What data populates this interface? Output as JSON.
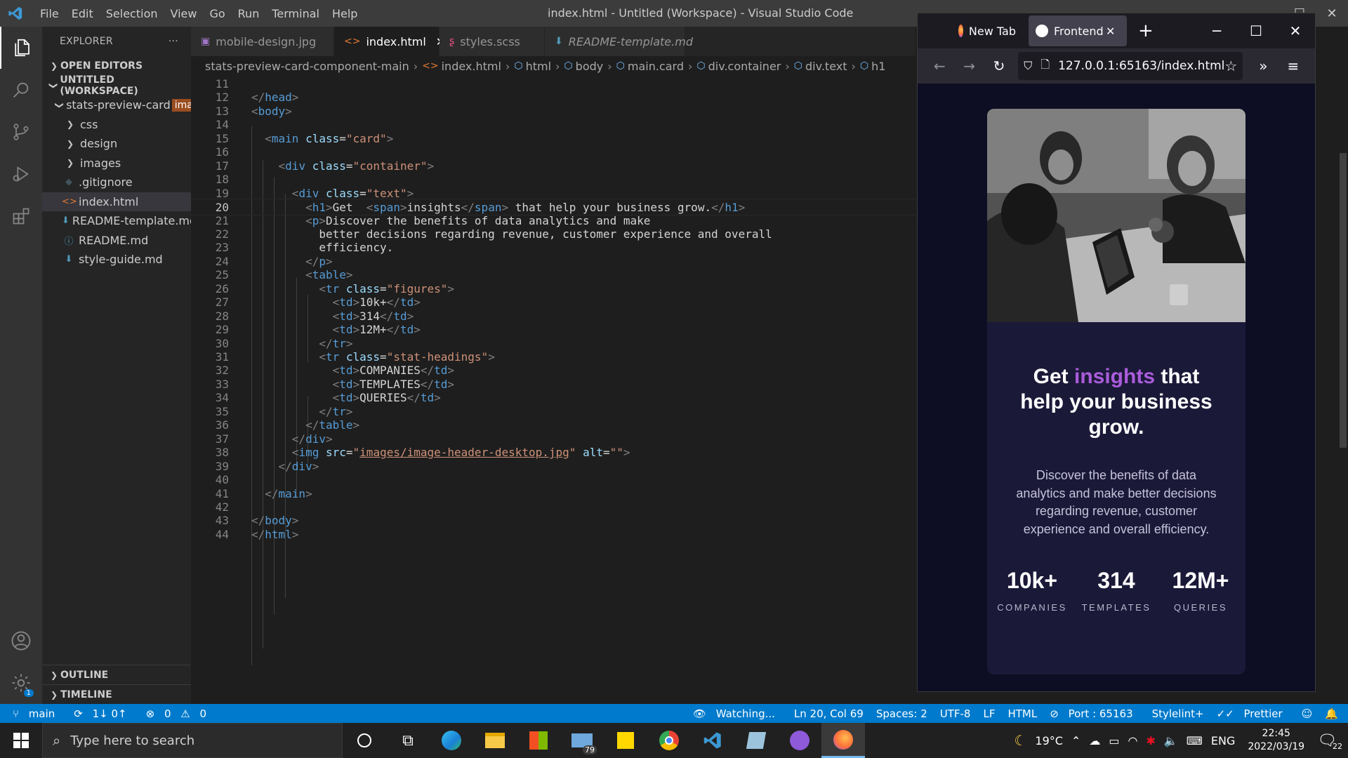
{
  "titlebar": {
    "menu": [
      "File",
      "Edit",
      "Selection",
      "View",
      "Go",
      "Run",
      "Terminal",
      "Help"
    ],
    "title": "index.html - Untitled (Workspace) - Visual Studio Code"
  },
  "activitybar": {
    "icons": [
      "explorer-icon",
      "search-icon",
      "source-control-icon",
      "run-debug-icon",
      "extensions-icon"
    ],
    "bottom_icons": [
      "accounts-icon",
      "settings-gear-icon"
    ],
    "settings_badge": "1"
  },
  "sidebar": {
    "header": "EXPLORER",
    "more": "···",
    "open_editors": "OPEN EDITORS",
    "workspace": "UNTITLED (WORKSPACE)",
    "root_folder": "stats-preview-card",
    "hover_tooltip": "ima",
    "items": [
      {
        "label": "css",
        "type": "folder"
      },
      {
        "label": "design",
        "type": "folder"
      },
      {
        "label": "images",
        "type": "folder"
      },
      {
        "label": ".gitignore",
        "type": "file"
      },
      {
        "label": "index.html",
        "type": "file"
      },
      {
        "label": "README-template.md",
        "type": "file"
      },
      {
        "label": "README.md",
        "type": "file"
      },
      {
        "label": "style-guide.md",
        "type": "file"
      }
    ],
    "outline": "OUTLINE",
    "timeline": "TIMELINE"
  },
  "tabs": [
    {
      "label": "mobile-design.jpg",
      "active": false
    },
    {
      "label": "index.html",
      "active": true
    },
    {
      "label": "styles.scss",
      "active": false
    },
    {
      "label": "README-template.md",
      "active": false
    }
  ],
  "breadcrumb": [
    "stats-preview-card-component-main",
    "index.html",
    "html",
    "body",
    "main.card",
    "div.container",
    "div.text",
    "h1"
  ],
  "editor": {
    "current_line": 20,
    "lines": [
      {
        "n": "11",
        "code": ""
      },
      {
        "n": "12",
        "code": "</head>"
      },
      {
        "n": "13",
        "code": "<body>"
      },
      {
        "n": "14",
        "code": ""
      },
      {
        "n": "15",
        "code": "  <main class=\"card\">"
      },
      {
        "n": "16",
        "code": ""
      },
      {
        "n": "17",
        "code": "    <div class=\"container\">"
      },
      {
        "n": "18",
        "code": ""
      },
      {
        "n": "19",
        "code": "      <div class=\"text\">"
      },
      {
        "n": "20",
        "code": "        <h1>Get  <span>insights</span> that help your business grow.</h1>"
      },
      {
        "n": "21",
        "code": "        <p>Discover the benefits of data analytics and make"
      },
      {
        "n": "22",
        "code": "          better decisions regarding revenue, customer experience and overall"
      },
      {
        "n": "23",
        "code": "          efficiency."
      },
      {
        "n": "24",
        "code": "        </p>"
      },
      {
        "n": "25",
        "code": "        <table>"
      },
      {
        "n": "26",
        "code": "          <tr class=\"figures\">"
      },
      {
        "n": "27",
        "code": "            <td>10k+</td>"
      },
      {
        "n": "28",
        "code": "            <td>314</td>"
      },
      {
        "n": "29",
        "code": "            <td>12M+</td>"
      },
      {
        "n": "30",
        "code": "          </tr>"
      },
      {
        "n": "31",
        "code": "          <tr class=\"stat-headings\">"
      },
      {
        "n": "32",
        "code": "            <td>COMPANIES</td>"
      },
      {
        "n": "33",
        "code": "            <td>TEMPLATES</td>"
      },
      {
        "n": "34",
        "code": "            <td>QUERIES</td>"
      },
      {
        "n": "35",
        "code": "          </tr>"
      },
      {
        "n": "36",
        "code": "        </table>"
      },
      {
        "n": "37",
        "code": "      </div>"
      },
      {
        "n": "38",
        "code": "      <img src=\"images/image-header-desktop.jpg\" alt=\"\">"
      },
      {
        "n": "39",
        "code": "    </div>"
      },
      {
        "n": "40",
        "code": ""
      },
      {
        "n": "41",
        "code": "  </main>"
      },
      {
        "n": "42",
        "code": ""
      },
      {
        "n": "43",
        "code": "</body>"
      },
      {
        "n": "44",
        "code": "</html>"
      }
    ]
  },
  "statusbar": {
    "branch": "main",
    "sync": "1↓ 0↑",
    "problems": "0",
    "warnings": "0",
    "watching": "Watching...",
    "position": "Ln 20, Col 69",
    "spaces": "Spaces: 2",
    "encoding": "UTF-8",
    "eol": "LF",
    "language": "HTML",
    "port": "Port : 65163",
    "stylelint": "Stylelint+",
    "prettier": "Prettier"
  },
  "firefox": {
    "tabs": [
      {
        "label": "New Tab",
        "active": false
      },
      {
        "label": "Frontend M",
        "active": true
      }
    ],
    "url": "127.0.0.1:65163/index.html"
  },
  "card": {
    "title_pre": "Get ",
    "title_highlight": "insights",
    "title_post": " that help your business grow.",
    "description": "Discover the benefits of data analytics and make better decisions regarding revenue, customer experience and overall efficiency.",
    "stats": [
      {
        "value": "10k+",
        "label": "COMPANIES"
      },
      {
        "value": "314",
        "label": "TEMPLATES"
      },
      {
        "value": "12M+",
        "label": "QUERIES"
      }
    ],
    "accent_color": "#aa5cdb"
  },
  "taskbar": {
    "search_placeholder": "Type here to search",
    "apps": [
      "task-view-icon",
      "timeline-icon",
      "edge-icon",
      "file-explorer-icon",
      "store-icon",
      "mail-icon",
      "sticky-notes-icon",
      "chrome-icon",
      "vscode-icon",
      "virtualbox-icon",
      "github-desktop-icon",
      "firefox-icon"
    ],
    "mail_badge": "79",
    "weather": "19°C",
    "language": "ENG",
    "time": "22:45",
    "date": "2022/03/19",
    "notification_count": "22"
  }
}
